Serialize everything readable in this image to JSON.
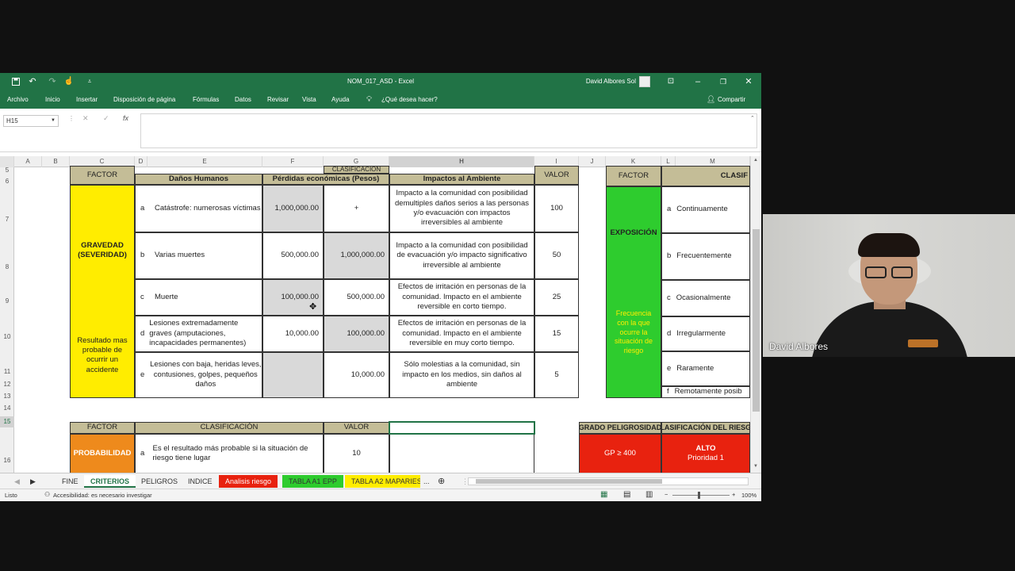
{
  "window": {
    "filename": "NOM_017_ASD",
    "app": "Excel",
    "user": "David Albores Sol",
    "accent": "#217346"
  },
  "ribbon": {
    "tabs": [
      "Archivo",
      "Inicio",
      "Insertar",
      "Disposición de página",
      "Fórmulas",
      "Datos",
      "Revisar",
      "Vista",
      "Ayuda"
    ],
    "search": "¿Qué desea hacer?",
    "share": "Compartir"
  },
  "formula_bar": {
    "cell": "H15",
    "fx": "fx",
    "value": ""
  },
  "columns": [
    "A",
    "B",
    "C",
    "D",
    "E",
    "F",
    "G",
    "H",
    "I",
    "J",
    "K",
    "L",
    "M"
  ],
  "rows": [
    "5",
    "6",
    "7",
    "8",
    "9",
    "10",
    "11",
    "12",
    "13",
    "14",
    "15",
    "16"
  ],
  "table1": {
    "clasificacion": "CLASIFICACIÓN",
    "factor": "FACTOR",
    "danos": "Daños Humanos",
    "perdidas": "Pérdidas económicas (Pesos)",
    "impactos": "Impactos al Ambiente",
    "valor": "VALOR",
    "gravedad": "GRAVEDAD (SEVERIDAD)",
    "gravedad_desc": "Resultado mas probable de ocurrir un accidente",
    "rows": [
      {
        "letter": "a",
        "dano": "Catástrofe: numerosas víctimas",
        "f": "1,000,000.00",
        "g": "+",
        "impacto": "Impacto a la comunidad con posibilidad demultiples daños serios a las personas y/o evacuación con impactos irreversibles al ambiente",
        "valor": "100"
      },
      {
        "letter": "b",
        "dano": "Varias muertes",
        "f": "500,000.00",
        "g": "1,000,000.00",
        "impacto": "Impacto a la comunidad con posibilidad de evacuación y/o impacto significativo irreversible al ambiente",
        "valor": "50"
      },
      {
        "letter": "c",
        "dano": "Muerte",
        "f": "100,000.00",
        "g": "500,000.00",
        "impacto": "Efectos de irritación en personas de la comunidad. Impacto en el ambiente reversible en corto tiempo.",
        "valor": "25"
      },
      {
        "letter": "d",
        "dano": "Lesiones extremadamente graves (amputaciones, incapacidades permanentes)",
        "f": "10,000.00",
        "g": "100,000.00",
        "impacto": "Efectos de irritación en personas de la comunidad. Impacto en el ambiente reversible en muy corto tiempo.",
        "valor": "15"
      },
      {
        "letter": "e",
        "dano": "Lesiones con baja, heridas leves, contusiones, golpes, pequeños daños",
        "f": "",
        "g": "10,000.00",
        "impacto": "Sólo molestias a la comunidad, sin impacto en los medios, sin daños al ambiente",
        "valor": "5"
      }
    ]
  },
  "table2": {
    "factor": "FACTOR",
    "clasif": "CLASIF",
    "exposicion": "EXPOSICIÓN",
    "exposicion_desc": "Frecuencia con la que ocurre la situación de riesgo",
    "items": [
      {
        "letter": "a",
        "label": "Continuamente"
      },
      {
        "letter": "b",
        "label": "Frecuentemente"
      },
      {
        "letter": "c",
        "label": "Ocasionalmente"
      },
      {
        "letter": "d",
        "label": "Irregularmente"
      },
      {
        "letter": "e",
        "label": "Raramente"
      },
      {
        "letter": "f",
        "label": "Remotamente posib"
      }
    ]
  },
  "table3": {
    "factor": "FACTOR",
    "clasificacion": "CLASIFICACIÓN",
    "valor": "VALOR",
    "probabilidad": "PROBABILIDAD",
    "row_letter": "a",
    "row_text": "Es el resultado más probable si la situación de riesgo tiene lugar",
    "row_valor": "10"
  },
  "table4": {
    "grado": "GRADO PELIGROSIDAD",
    "clasif_riesgo": "CLASIFICACIÓN DEL RIESGO",
    "gp": "GP ≥ 400",
    "alto": "ALTO",
    "prioridad": "Prioridad 1"
  },
  "sheet_tabs": [
    {
      "label": "FINE",
      "color": ""
    },
    {
      "label": "CRITERIOS",
      "color": "active"
    },
    {
      "label": "PELIGROS",
      "color": ""
    },
    {
      "label": "INDICE",
      "color": ""
    },
    {
      "label": "Analisis riesgo",
      "color": "#e8220f"
    },
    {
      "label": "TABLA A1 EPP",
      "color": "#2ecc2e"
    },
    {
      "label": "TABLA A2 MAPARIES",
      "color": "#ffed00"
    }
  ],
  "status": {
    "ready": "Listo",
    "accessibility": "Accesibilidad: es necesario investigar",
    "zoom": "100%"
  },
  "webcam": {
    "name": "David Albores"
  }
}
